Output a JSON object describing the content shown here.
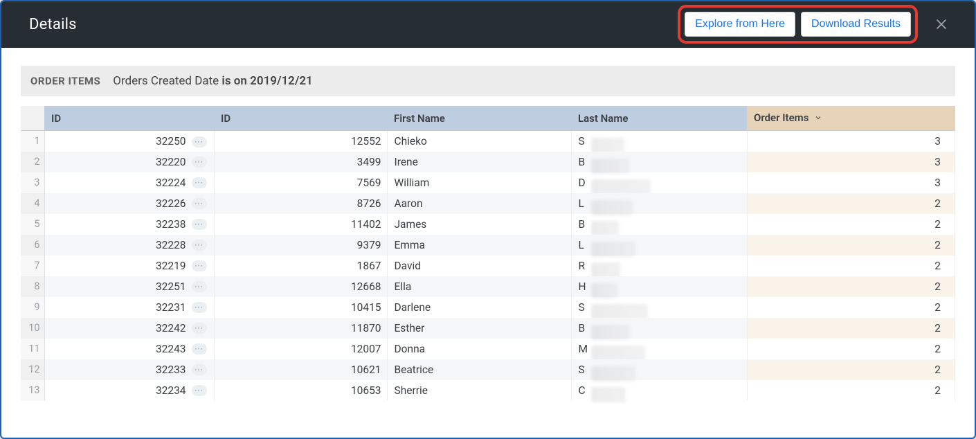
{
  "header": {
    "title": "Details",
    "explore_label": "Explore from Here",
    "download_label": "Download Results"
  },
  "filter": {
    "section_label": "ORDER ITEMS",
    "field_label": "Orders Created Date",
    "condition_label": "is on 2019/12/21"
  },
  "columns": {
    "id1": "ID",
    "id2": "ID",
    "first_name": "First Name",
    "last_name": "Last Name",
    "order_items": "Order Items"
  },
  "rows": [
    {
      "n": "1",
      "id1": "32250",
      "id2": "12552",
      "first": "Chieko",
      "last": "S",
      "items": "3",
      "blurw": 48
    },
    {
      "n": "2",
      "id1": "32220",
      "id2": "3499",
      "first": "Irene",
      "last": "B",
      "items": "3",
      "blurw": 54
    },
    {
      "n": "3",
      "id1": "32224",
      "id2": "7569",
      "first": "William",
      "last": "D",
      "items": "3",
      "blurw": 86
    },
    {
      "n": "4",
      "id1": "32226",
      "id2": "8726",
      "first": "Aaron",
      "last": "L",
      "items": "2",
      "blurw": 60
    },
    {
      "n": "5",
      "id1": "32238",
      "id2": "11402",
      "first": "James",
      "last": "B",
      "items": "2",
      "blurw": 40
    },
    {
      "n": "6",
      "id1": "32228",
      "id2": "9379",
      "first": "Emma",
      "last": "L",
      "items": "2",
      "blurw": 64
    },
    {
      "n": "7",
      "id1": "32219",
      "id2": "1867",
      "first": "David",
      "last": "R",
      "items": "2",
      "blurw": 42
    },
    {
      "n": "8",
      "id1": "32251",
      "id2": "12668",
      "first": "Ella",
      "last": "H",
      "items": "2",
      "blurw": 38
    },
    {
      "n": "9",
      "id1": "32231",
      "id2": "10415",
      "first": "Darlene",
      "last": "S",
      "items": "2",
      "blurw": 82
    },
    {
      "n": "10",
      "id1": "32242",
      "id2": "11870",
      "first": "Esther",
      "last": "B",
      "items": "2",
      "blurw": 56
    },
    {
      "n": "11",
      "id1": "32243",
      "id2": "12007",
      "first": "Donna",
      "last": "M",
      "items": "2",
      "blurw": 78
    },
    {
      "n": "12",
      "id1": "32233",
      "id2": "10621",
      "first": "Beatrice",
      "last": "S",
      "items": "2",
      "blurw": 64
    },
    {
      "n": "13",
      "id1": "32234",
      "id2": "10653",
      "first": "Sherrie",
      "last": "C",
      "items": "2",
      "blurw": 50
    }
  ]
}
